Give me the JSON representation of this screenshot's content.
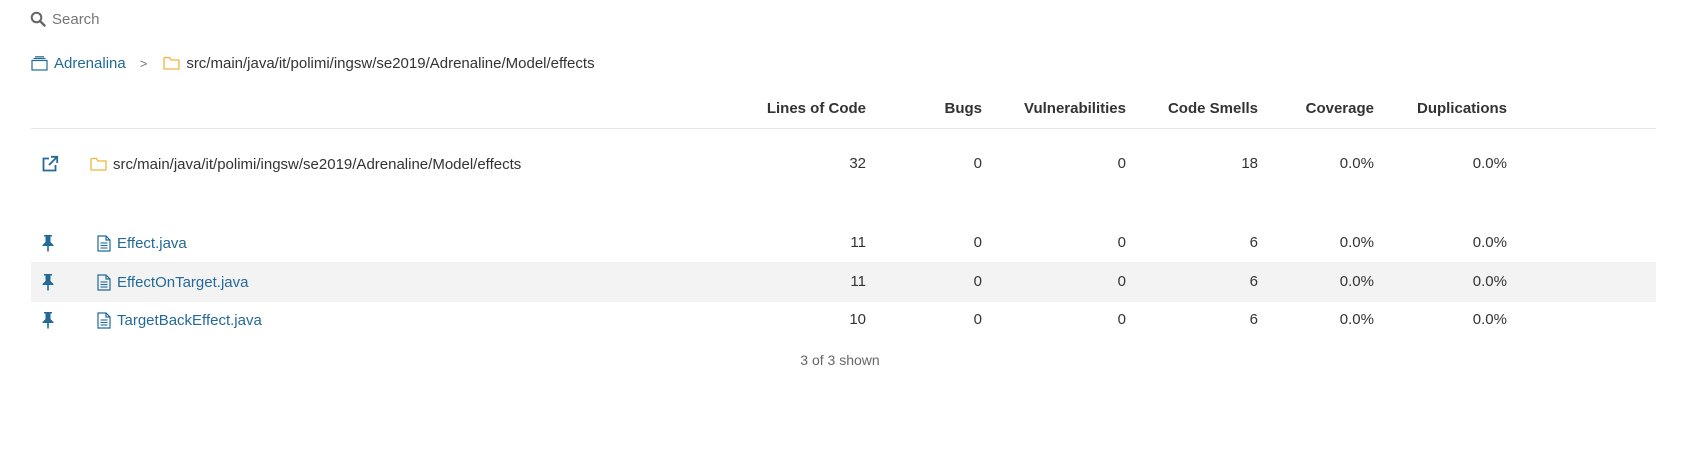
{
  "search": {
    "placeholder": "Search"
  },
  "breadcrumb": {
    "project": "Adrenalina",
    "separator": ">",
    "path": "src/main/java/it/polimi/ingsw/se2019/Adrenaline/Model/effects"
  },
  "table": {
    "columns": [
      "Lines of Code",
      "Bugs",
      "Vulnerabilities",
      "Code Smells",
      "Coverage",
      "Duplications"
    ],
    "directory": {
      "name": "src/main/java/it/polimi/ingsw/se2019/Adrenaline/Model/effects",
      "lines_of_code": "32",
      "bugs": "0",
      "vulnerabilities": "0",
      "code_smells": "18",
      "coverage": "0.0%",
      "duplications": "0.0%"
    },
    "files": [
      {
        "name": "Effect.java",
        "lines_of_code": "11",
        "bugs": "0",
        "vulnerabilities": "0",
        "code_smells": "6",
        "coverage": "0.0%",
        "duplications": "0.0%"
      },
      {
        "name": "EffectOnTarget.java",
        "lines_of_code": "11",
        "bugs": "0",
        "vulnerabilities": "0",
        "code_smells": "6",
        "coverage": "0.0%",
        "duplications": "0.0%"
      },
      {
        "name": "TargetBackEffect.java",
        "lines_of_code": "10",
        "bugs": "0",
        "vulnerabilities": "0",
        "code_smells": "6",
        "coverage": "0.0%",
        "duplications": "0.0%"
      }
    ],
    "footer": "3 of 3 shown"
  },
  "colors": {
    "link": "#236a97",
    "folder": "#f0b43c",
    "row_highlight": "#f3f3f3"
  },
  "icons": [
    "search-icon",
    "project-icon",
    "folder-icon",
    "external-link-icon",
    "pin-icon",
    "file-icon"
  ]
}
